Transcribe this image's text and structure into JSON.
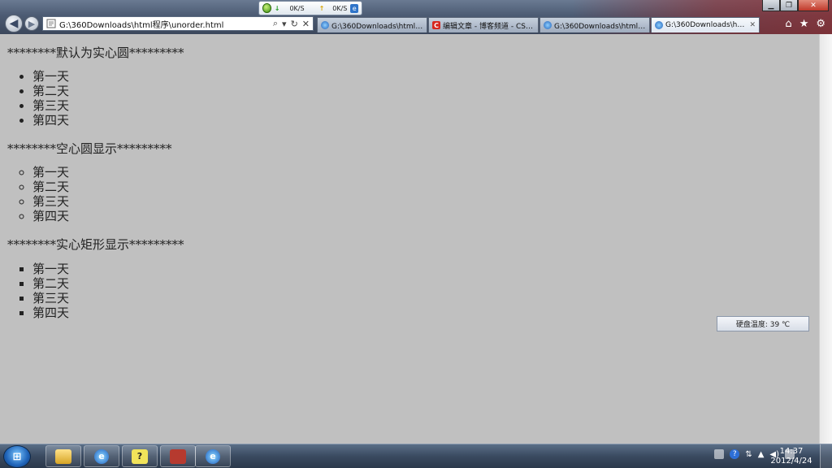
{
  "browser": {
    "address": "G:\\360Downloads\\html程序\\unorder.html",
    "speed": {
      "down": "0K/S",
      "up": "0K/S"
    },
    "tabs": [
      {
        "label": "G:\\360Downloads\\html程...",
        "icon": "ie-icon",
        "active": false
      },
      {
        "label": "编辑文章 - 博客频道 - CSD...",
        "icon": "csdn-icon",
        "active": false
      },
      {
        "label": "G:\\360Downloads\\html程...",
        "icon": "ie-icon",
        "active": false
      },
      {
        "label": "G:\\360Downloads\\htm...",
        "icon": "ie-icon",
        "active": true
      }
    ]
  },
  "content": {
    "heading_disc": "********默认为实心圆*********",
    "heading_circle": "********空心圆显示*********",
    "heading_square": "********实心矩形显示*********",
    "list_disc": [
      "第一天",
      "第二天",
      "第三天",
      "第四天"
    ],
    "list_circle": [
      "第一天",
      "第二天",
      "第三天",
      "第四天"
    ],
    "list_square": [
      "第一天",
      "第二天",
      "第三天",
      "第四天"
    ]
  },
  "widget": {
    "hdd_temp": "硬盘温度: 39 ℃"
  },
  "taskbar": {
    "time": "14:37",
    "date": "2012/4/24"
  }
}
